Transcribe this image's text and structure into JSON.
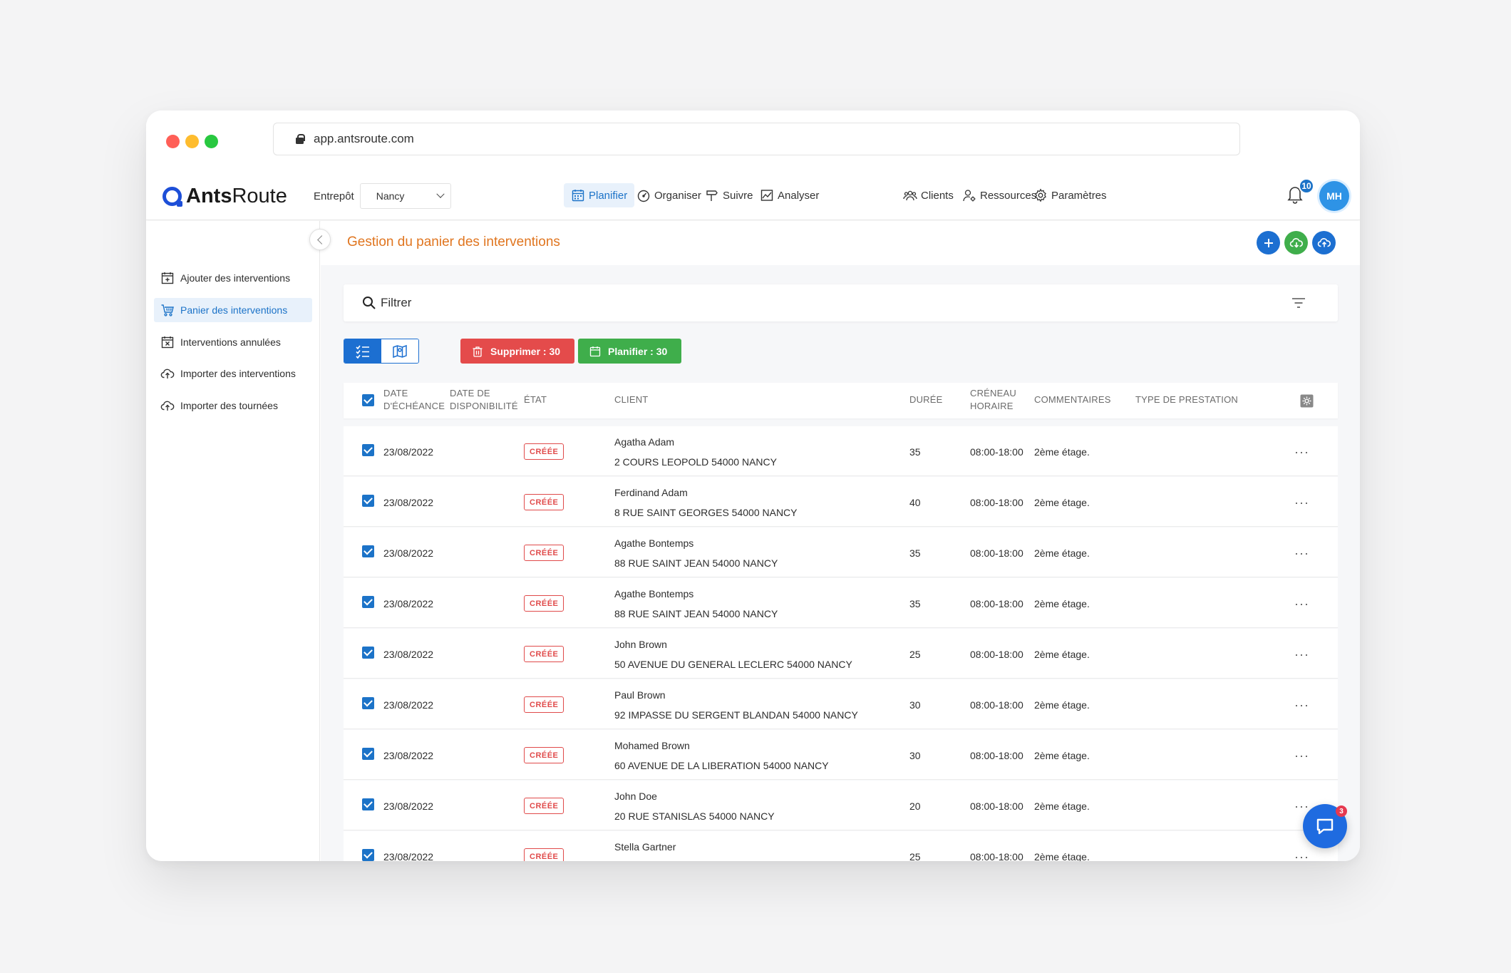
{
  "browser": {
    "url": "app.antsroute.com"
  },
  "app": {
    "logo_bold": "Ants",
    "logo_light": "Route",
    "warehouse_label": "Entrepôt",
    "warehouse_value": "Nancy",
    "nav": {
      "plan": "Planifier",
      "organize": "Organiser",
      "track": "Suivre",
      "analyze": "Analyser",
      "clients": "Clients",
      "resources": "Ressources",
      "settings": "Paramètres"
    },
    "notifications_count": "10",
    "avatar_initials": "MH"
  },
  "sidebar": {
    "items": [
      {
        "label": "Ajouter des interventions",
        "icon": "calendar-plus-icon"
      },
      {
        "label": "Panier des interventions",
        "icon": "cart-icon",
        "active": true
      },
      {
        "label": "Interventions annulées",
        "icon": "calendar-x-icon"
      },
      {
        "label": "Importer des interventions",
        "icon": "cloud-upload-icon"
      },
      {
        "label": "Importer des tournées",
        "icon": "cloud-upload-icon"
      }
    ]
  },
  "page": {
    "title": "Gestion du panier des interventions",
    "filter_placeholder": "Filtrer",
    "delete_label": "Supprimer : 30",
    "plan_label": "Planifier : 30"
  },
  "table": {
    "headers": {
      "due_1": "DATE",
      "due_2": "D'ÉCHÉANCE",
      "avail_1": "DATE DE",
      "avail_2": "DISPONIBILITÉ",
      "state": "ÉTAT",
      "client": "CLIENT",
      "duration": "DURÉE",
      "slot_1": "CRÉNEAU",
      "slot_2": "HORAIRE",
      "comments": "COMMENTAIRES",
      "service_type": "TYPE DE PRESTATION"
    },
    "rows": [
      {
        "due": "23/08/2022",
        "state": "CRÉÉE",
        "name": "Agatha Adam",
        "address": "2 COURS LEOPOLD 54000 NANCY",
        "duration": "35",
        "slot": "08:00-18:00",
        "comment": "2ème étage."
      },
      {
        "due": "23/08/2022",
        "state": "CRÉÉE",
        "name": "Ferdinand Adam",
        "address": "8 RUE SAINT GEORGES 54000 NANCY",
        "duration": "40",
        "slot": "08:00-18:00",
        "comment": "2ème étage."
      },
      {
        "due": "23/08/2022",
        "state": "CRÉÉE",
        "name": "Agathe Bontemps",
        "address": "88 RUE SAINT JEAN 54000 NANCY",
        "duration": "35",
        "slot": "08:00-18:00",
        "comment": "2ème étage."
      },
      {
        "due": "23/08/2022",
        "state": "CRÉÉE",
        "name": "Agathe Bontemps",
        "address": "88 RUE SAINT JEAN 54000 NANCY",
        "duration": "35",
        "slot": "08:00-18:00",
        "comment": "2ème étage."
      },
      {
        "due": "23/08/2022",
        "state": "CRÉÉE",
        "name": "John Brown",
        "address": "50 AVENUE DU GENERAL LECLERC 54000 NANCY",
        "duration": "25",
        "slot": "08:00-18:00",
        "comment": "2ème étage."
      },
      {
        "due": "23/08/2022",
        "state": "CRÉÉE",
        "name": "Paul Brown",
        "address": "92 IMPASSE DU SERGENT BLANDAN 54000 NANCY",
        "duration": "30",
        "slot": "08:00-18:00",
        "comment": "2ème étage."
      },
      {
        "due": "23/08/2022",
        "state": "CRÉÉE",
        "name": "Mohamed Brown",
        "address": "60 AVENUE DE LA LIBERATION 54000 NANCY",
        "duration": "30",
        "slot": "08:00-18:00",
        "comment": "2ème étage."
      },
      {
        "due": "23/08/2022",
        "state": "CRÉÉE",
        "name": "John Doe",
        "address": "20 RUE STANISLAS 54000 NANCY",
        "duration": "20",
        "slot": "08:00-18:00",
        "comment": "2ème étage."
      },
      {
        "due": "23/08/2022",
        "state": "CRÉÉE",
        "name": "Stella Gartner",
        "address": "",
        "duration": "25",
        "slot": "08:00-18:00",
        "comment": "2ème étage."
      }
    ],
    "more_label": "···"
  },
  "chat": {
    "badge": "3"
  },
  "colors": {
    "accent": "#1c73c8",
    "title_orange": "#e0751f",
    "danger": "#e44b4b",
    "success": "#3fae4b"
  }
}
